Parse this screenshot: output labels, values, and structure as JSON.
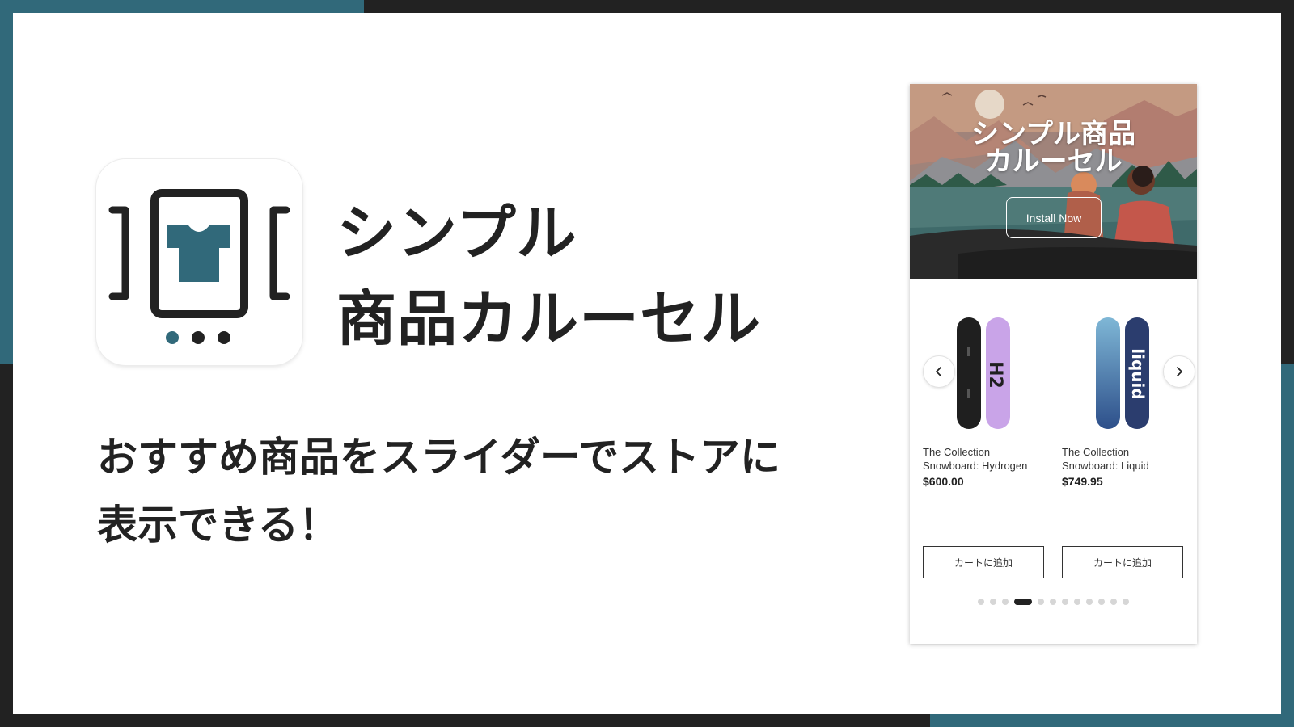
{
  "title": {
    "line1": "シンプル",
    "line2": "商品カルーセル"
  },
  "subtitle": {
    "line1": "おすすめ商品をスライダーでストアに",
    "line2": "表示できる！"
  },
  "colors": {
    "accent": "#31697a",
    "frame": "#222222",
    "background": "#ffffff"
  },
  "app_icon": {
    "name": "carousel-tshirt-app-icon",
    "page_count": 3,
    "active_page": 1
  },
  "mockup": {
    "banner": {
      "title_line1": "シンプル商品",
      "title_line2": "カルーセル",
      "button_label": "Install Now"
    },
    "products": [
      {
        "name": "The Collection Snowboard: Hydrogen",
        "price": "$600.00",
        "button_label": "カートに追加",
        "image_icon": "snowboard-hydrogen-image"
      },
      {
        "name": "The Collection Snowboard: Liquid",
        "price": "$749.95",
        "button_label": "カートに追加",
        "image_icon": "snowboard-liquid-image"
      }
    ],
    "nav": {
      "prev_icon": "chevron-left-icon",
      "next_icon": "chevron-right-icon"
    },
    "pagination": {
      "total": 12,
      "active": 4
    }
  }
}
